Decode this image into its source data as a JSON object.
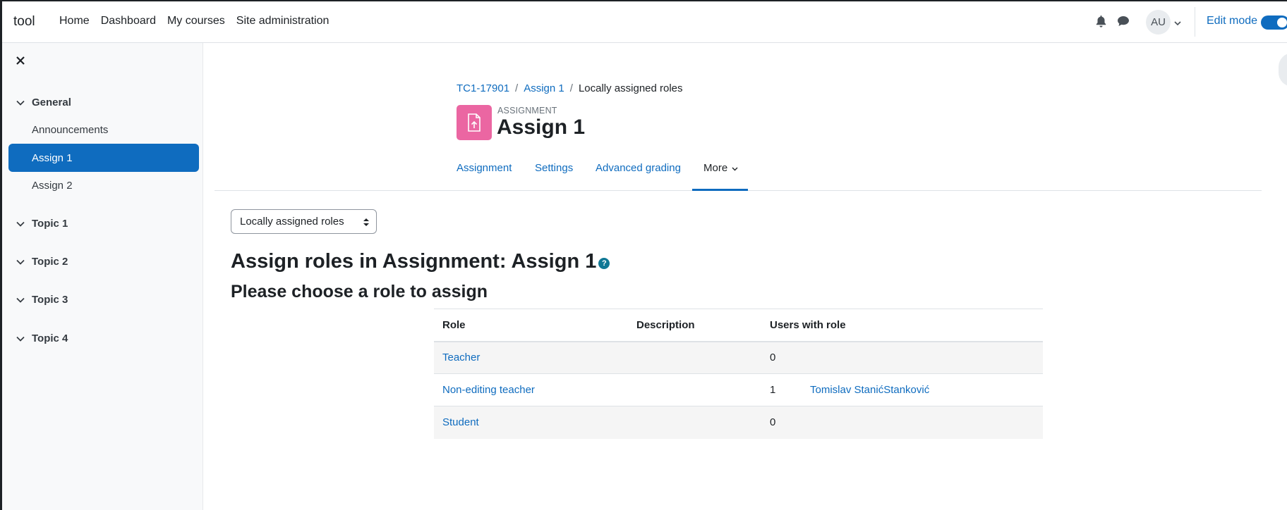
{
  "navbar": {
    "brand": "tool",
    "links": [
      "Home",
      "Dashboard",
      "My courses",
      "Site administration"
    ],
    "avatar_initials": "AU",
    "edit_mode_label": "Edit mode",
    "edit_mode_on": true
  },
  "drawer": {
    "sections": [
      {
        "title": "General",
        "items": [
          "Announcements",
          "Assign 1",
          "Assign 2"
        ],
        "active": "Assign 1"
      },
      {
        "title": "Topic 1"
      },
      {
        "title": "Topic 2"
      },
      {
        "title": "Topic 3"
      },
      {
        "title": "Topic 4"
      }
    ]
  },
  "breadcrumb": {
    "items": [
      "TC1-17901",
      "Assign 1",
      "Locally assigned roles"
    ]
  },
  "activity": {
    "type_label": "ASSIGNMENT",
    "title": "Assign 1",
    "icon_color": "#eb66a2"
  },
  "secondary_nav": {
    "tabs": [
      "Assignment",
      "Settings",
      "Advanced grading",
      "More"
    ],
    "active": "More"
  },
  "select": {
    "value": "Locally assigned roles"
  },
  "main": {
    "heading": "Assign roles in Assignment: Assign 1",
    "help_glyph": "?",
    "subheading": "Please choose a role to assign"
  },
  "table": {
    "headers": [
      "Role",
      "Description",
      "Users with role"
    ],
    "rows": [
      {
        "role": "Teacher",
        "description": "",
        "count": "0",
        "users": ""
      },
      {
        "role": "Non-editing teacher",
        "description": "",
        "count": "1",
        "users": "Tomislav StanićStanković"
      },
      {
        "role": "Student",
        "description": "",
        "count": "0",
        "users": ""
      }
    ]
  },
  "colors": {
    "primary": "#0f6cbf",
    "text": "#1d2125"
  }
}
